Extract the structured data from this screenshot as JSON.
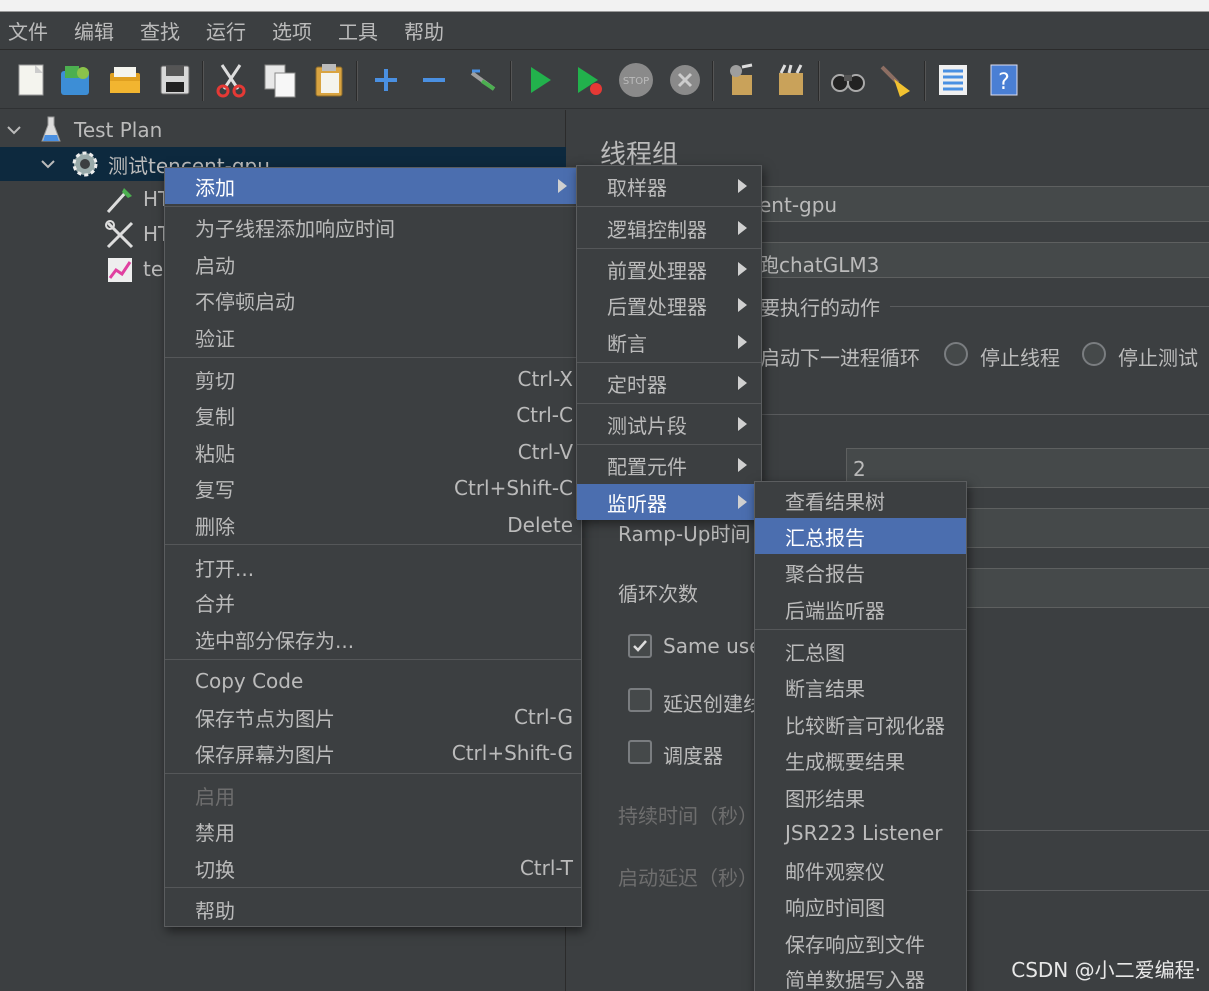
{
  "menubar": [
    "文件",
    "编辑",
    "查找",
    "运行",
    "选项",
    "工具",
    "帮助"
  ],
  "toolbar_icons": [
    "new-icon",
    "templates-icon",
    "open-icon",
    "save-icon",
    "cut-icon",
    "copy-icon",
    "paste-icon",
    "expand-icon",
    "collapse-icon",
    "toggle-icon",
    "start-icon",
    "start-no-pauses-icon",
    "stop-icon",
    "shutdown-icon",
    "clear-icon",
    "clear-all-icon",
    "search-icon",
    "reset-search-icon",
    "function-helper-icon",
    "help-icon"
  ],
  "tree": {
    "root": "Test Plan",
    "thread_group": "测试tencent-gpu",
    "children": [
      "HT",
      "HT",
      "ter"
    ]
  },
  "right_panel": {
    "title": "线程组",
    "name_value": "ent-gpu",
    "comment_value": "跑chatGLM3",
    "action_label": "要执行的动作",
    "radio_options": [
      "启动下一进程循环",
      "停止线程",
      "停止测试"
    ],
    "threads_value": "2",
    "rampup_label": "Ramp-Up时间",
    "loop_label": "循环次数",
    "same_user_label": "Same user",
    "delay_label": "延迟创建线",
    "scheduler_label": "调度器",
    "duration_label": "持续时间（秒）",
    "startup_delay_label": "启动延迟（秒）"
  },
  "context_menu": {
    "add": "添加",
    "add_response_time": "为子线程添加响应时间",
    "start": "启动",
    "start_no_pause": "不停顿启动",
    "validate": "验证",
    "cut": "剪切",
    "cut_sc": "Ctrl-X",
    "copy": "复制",
    "copy_sc": "Ctrl-C",
    "paste": "粘贴",
    "paste_sc": "Ctrl-V",
    "duplicate": "复写",
    "duplicate_sc": "Ctrl+Shift-C",
    "delete": "删除",
    "delete_sc": "Delete",
    "open": "打开...",
    "merge": "合并",
    "save_selection": "选中部分保存为...",
    "copy_code": "Copy Code",
    "save_node_image": "保存节点为图片",
    "save_node_image_sc": "Ctrl-G",
    "save_screen_image": "保存屏幕为图片",
    "save_screen_image_sc": "Ctrl+Shift-G",
    "enable": "启用",
    "disable": "禁用",
    "toggle": "切换",
    "toggle_sc": "Ctrl-T",
    "help": "帮助"
  },
  "add_submenu": [
    "取样器",
    "逻辑控制器",
    "前置处理器",
    "后置处理器",
    "断言",
    "定时器",
    "测试片段",
    "配置元件",
    "监听器"
  ],
  "listener_submenu": [
    "查看结果树",
    "汇总报告",
    "聚合报告",
    "后端监听器",
    "汇总图",
    "断言结果",
    "比较断言可视化器",
    "生成概要结果",
    "图形结果",
    "JSR223 Listener",
    "邮件观察仪",
    "响应时间图",
    "保存响应到文件",
    "简单数据写入器"
  ],
  "watermark": "CSDN @小二爱编程·",
  "colors": {
    "background": "#3c3f41",
    "selection": "#4b6eaf",
    "text": "#bbbbbb"
  }
}
